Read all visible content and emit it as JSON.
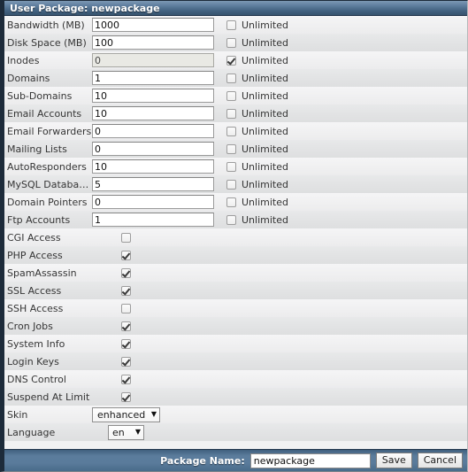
{
  "window": {
    "title": "User Package: newpackage"
  },
  "quota_rows": [
    {
      "label": "Bandwidth (MB)",
      "value": "1000",
      "unlimited": false,
      "unlimited_label": "Unlimited",
      "disabled": false
    },
    {
      "label": "Disk Space (MB)",
      "value": "100",
      "unlimited": false,
      "unlimited_label": "Unlimited",
      "disabled": false
    },
    {
      "label": "Inodes",
      "value": "0",
      "unlimited": true,
      "unlimited_label": "Unlimited",
      "disabled": true
    },
    {
      "label": "Domains",
      "value": "1",
      "unlimited": false,
      "unlimited_label": "Unlimited",
      "disabled": false
    },
    {
      "label": "Sub-Domains",
      "value": "10",
      "unlimited": false,
      "unlimited_label": "Unlimited",
      "disabled": false
    },
    {
      "label": "Email Accounts",
      "value": "10",
      "unlimited": false,
      "unlimited_label": "Unlimited",
      "disabled": false
    },
    {
      "label": "Email Forwarders",
      "value": "0",
      "unlimited": false,
      "unlimited_label": "Unlimited",
      "disabled": false
    },
    {
      "label": "Mailing Lists",
      "value": "0",
      "unlimited": false,
      "unlimited_label": "Unlimited",
      "disabled": false
    },
    {
      "label": "AutoResponders",
      "value": "10",
      "unlimited": false,
      "unlimited_label": "Unlimited",
      "disabled": false
    },
    {
      "label": "MySQL Databases",
      "value": "5",
      "unlimited": false,
      "unlimited_label": "Unlimited",
      "disabled": false
    },
    {
      "label": "Domain Pointers",
      "value": "0",
      "unlimited": false,
      "unlimited_label": "Unlimited",
      "disabled": false
    },
    {
      "label": "Ftp Accounts",
      "value": "1",
      "unlimited": false,
      "unlimited_label": "Unlimited",
      "disabled": false
    }
  ],
  "feature_rows": [
    {
      "label": "CGI Access",
      "checked": false
    },
    {
      "label": "PHP Access",
      "checked": true
    },
    {
      "label": "SpamAssassin",
      "checked": true
    },
    {
      "label": "SSL Access",
      "checked": true
    },
    {
      "label": "SSH Access",
      "checked": false
    },
    {
      "label": "Cron Jobs",
      "checked": true
    },
    {
      "label": "System Info",
      "checked": true
    },
    {
      "label": "Login Keys",
      "checked": true
    },
    {
      "label": "DNS Control",
      "checked": true
    },
    {
      "label": "Suspend At Limit",
      "checked": true
    }
  ],
  "select_rows": [
    {
      "label": "Skin",
      "value": "enhanced",
      "kind": "skin",
      "caret": "▼"
    },
    {
      "label": "Language",
      "value": "en",
      "kind": "lang",
      "caret": "▼"
    }
  ],
  "footer": {
    "package_name_label": "Package Name:",
    "package_name_value": "newpackage",
    "save_label": "Save",
    "cancel_label": "Cancel"
  },
  "colors": {
    "titlebar_top": "#7d99b4",
    "titlebar_bottom": "#36536e",
    "footer_bg": "#5b7c9c",
    "row_odd": "#f2f2f3",
    "row_even": "#e4e5e6",
    "border_dark": "#1d2b3a"
  }
}
